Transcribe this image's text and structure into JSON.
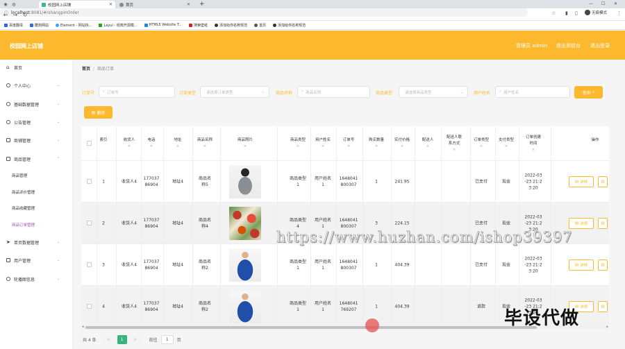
{
  "browser": {
    "tabs": [
      {
        "label": "校园网上店铺"
      },
      {
        "label": "首页"
      }
    ],
    "url_host": "localhost",
    "url_rest": ":8081/#/shangpinOrder",
    "profile_label": "无痕模式",
    "bookmarks": [
      "百度翻译",
      "酷狗网站",
      "Element - 网站快...",
      "Layui - 经典开源模...",
      "HTML5 Website T...",
      "搜索壁纸",
      "添加给你名称规范",
      "首页",
      "添加给你名称规范"
    ]
  },
  "header": {
    "title": "校园网上店铺",
    "links": [
      "管理员 admin",
      "退出到前台",
      "退出登录"
    ]
  },
  "sidebar": {
    "items": [
      {
        "label": "首页",
        "chevron": ""
      },
      {
        "label": "个人中心",
        "chevron": "⌄"
      },
      {
        "label": "基础数据管理",
        "chevron": "⌄"
      },
      {
        "label": "公告管理",
        "chevron": "⌄"
      },
      {
        "label": "商铺管理",
        "chevron": "⌄"
      },
      {
        "label": "商品管理",
        "chevron": "⌃"
      }
    ],
    "subitems": [
      "商品管理",
      "商品评价管理",
      "商品收藏管理",
      "商品订单管理"
    ],
    "items2": [
      {
        "label": "单页数据管理",
        "chevron": "⌄"
      },
      {
        "label": "用户管理",
        "chevron": "⌄"
      },
      {
        "label": "轮播图信息",
        "chevron": "⌄"
      }
    ]
  },
  "breadcrumb": {
    "home": "首页",
    "sep": "/",
    "current": "商品订单"
  },
  "filters": {
    "order_no_label": "订单号",
    "order_no_placeholder": "订单号",
    "order_type_label": "订单类型",
    "order_type_placeholder": "请选择订单类型",
    "product_name_label": "商品名称",
    "product_name_placeholder": "商品名称",
    "product_type_label": "商品类型",
    "product_type_placeholder": "请选择商品类型",
    "user_name_label": "用户姓名",
    "user_name_placeholder": "用户姓名",
    "search_label": "查询",
    "delete_label": "删除"
  },
  "table": {
    "headers": [
      {
        "label": "索引",
        "sort": ""
      },
      {
        "label": "收货人",
        "sort": "≑"
      },
      {
        "label": "电话",
        "sort": "≑"
      },
      {
        "label": "地址",
        "sort": "≑"
      },
      {
        "label": "商品名称",
        "sort": "≑"
      },
      {
        "label": "商品照片",
        "sort": "≑"
      },
      {
        "label": "商品类型",
        "sort": "≑"
      },
      {
        "label": "用户姓名",
        "sort": "≑"
      },
      {
        "label": "订单号",
        "sort": "≑"
      },
      {
        "label": "购买数量",
        "sort": "≑"
      },
      {
        "label": "实付价格",
        "sort": "≑"
      },
      {
        "label": "配送人",
        "sort": "≑"
      },
      {
        "label": "配送人联系方式",
        "sort": "≑"
      },
      {
        "label": "订单类型",
        "sort": "≑"
      },
      {
        "label": "支付类型",
        "sort": "≑"
      },
      {
        "label": "订单创建时间",
        "sort": "≑"
      },
      {
        "label": "操作",
        "sort": ""
      }
    ],
    "rows": [
      {
        "index": "1",
        "consignee": "收货人4",
        "phone": "17703786904",
        "address": "地址4",
        "product_name": "商品名称5",
        "product_type": "商品类型1",
        "user_name": "用户姓名1",
        "order_no": "1648041800307",
        "qty": "1",
        "price": "241.95",
        "deliverer": "",
        "deliverer_phone": "",
        "order_type": "已支付",
        "pay_type": "现金",
        "created": "2022-03-23 21:23:20",
        "image": "woman-gray-top"
      },
      {
        "index": "2",
        "consignee": "收货人4",
        "phone": "17703786904",
        "address": "地址4",
        "product_name": "商品名称4",
        "product_type": "商品类型4",
        "user_name": "用户姓名1",
        "order_no": "1648041800307",
        "qty": "3",
        "price": "224.15",
        "deliverer": "",
        "deliverer_phone": "",
        "order_type": "已支付",
        "pay_type": "现金",
        "created": "2022-03-23 21:23:20",
        "image": "floral-fabric"
      },
      {
        "index": "3",
        "consignee": "收货人4",
        "phone": "17703786904",
        "address": "地址4",
        "product_name": "商品名称2",
        "product_type": "商品类型1",
        "user_name": "用户姓名1",
        "order_no": "1648041800307",
        "qty": "1",
        "price": "404.39",
        "deliverer": "",
        "deliverer_phone": "",
        "order_type": "已支付",
        "pay_type": "现金",
        "created": "2022-03-23 21:23:20",
        "image": "man-blue-sweater"
      },
      {
        "index": "4",
        "consignee": "收货人4",
        "phone": "17703786904",
        "address": "地址4",
        "product_name": "商品名称2",
        "product_type": "商品类型1",
        "user_name": "用户姓名1",
        "order_no": "1648041769207",
        "qty": "1",
        "price": "404.39",
        "deliverer": "",
        "deliverer_phone": "",
        "order_type": "退款",
        "pay_type": "现金",
        "created": "2022-03-23 21:23:20",
        "image": "man-blue-sweater"
      }
    ],
    "detail_label": "详情",
    "delete_icon": "trash-icon"
  },
  "pagination": {
    "total": "共 4 条",
    "prev": "<",
    "current": "1",
    "next": ">",
    "goto_label": "前往",
    "goto_value": "1",
    "page_suffix": "页"
  },
  "watermark": "https://www.huzhan.com/ishop39397",
  "watermark2": "毕设代做",
  "colors": {
    "accent": "#fdb92d",
    "active_sub": "#a64ec0",
    "page_current": "#36b37e"
  }
}
